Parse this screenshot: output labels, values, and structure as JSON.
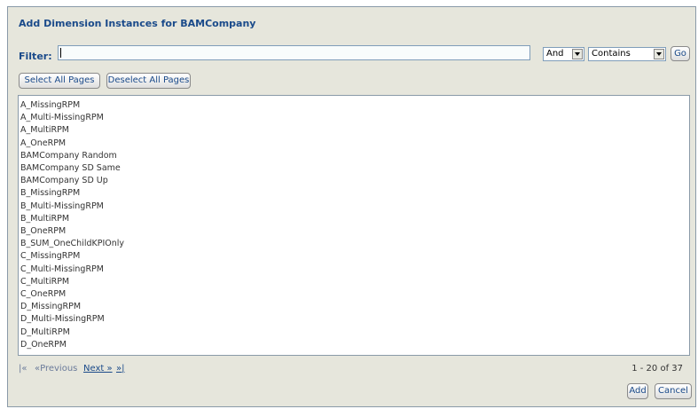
{
  "dialog": {
    "title": "Add Dimension Instances for BAMCompany"
  },
  "filter": {
    "label": "Filter:",
    "value": "",
    "logic_select": "And",
    "match_select": "Contains",
    "go_label": "Go"
  },
  "toolbar": {
    "select_all_label": "Select All Pages",
    "deselect_all_label": "Deselect All Pages"
  },
  "items": [
    "A_MissingRPM",
    "A_Multi-MissingRPM",
    "A_MultiRPM",
    "A_OneRPM",
    "BAMCompany Random",
    "BAMCompany SD Same",
    "BAMCompany SD Up",
    "B_MissingRPM",
    "B_Multi-MissingRPM",
    "B_MultiRPM",
    "B_OneRPM",
    "B_SUM_OneChildKPIOnly",
    "C_MissingRPM",
    "C_Multi-MissingRPM",
    "C_MultiRPM",
    "C_OneRPM",
    "D_MissingRPM",
    "D_Multi-MissingRPM",
    "D_MultiRPM",
    "D_OneRPM"
  ],
  "pager": {
    "first": "|«",
    "previous": "«Previous",
    "next": "Next »",
    "last": "»|",
    "range": "1 - 20 of 37"
  },
  "actions": {
    "add_label": "Add",
    "cancel_label": "Cancel"
  }
}
